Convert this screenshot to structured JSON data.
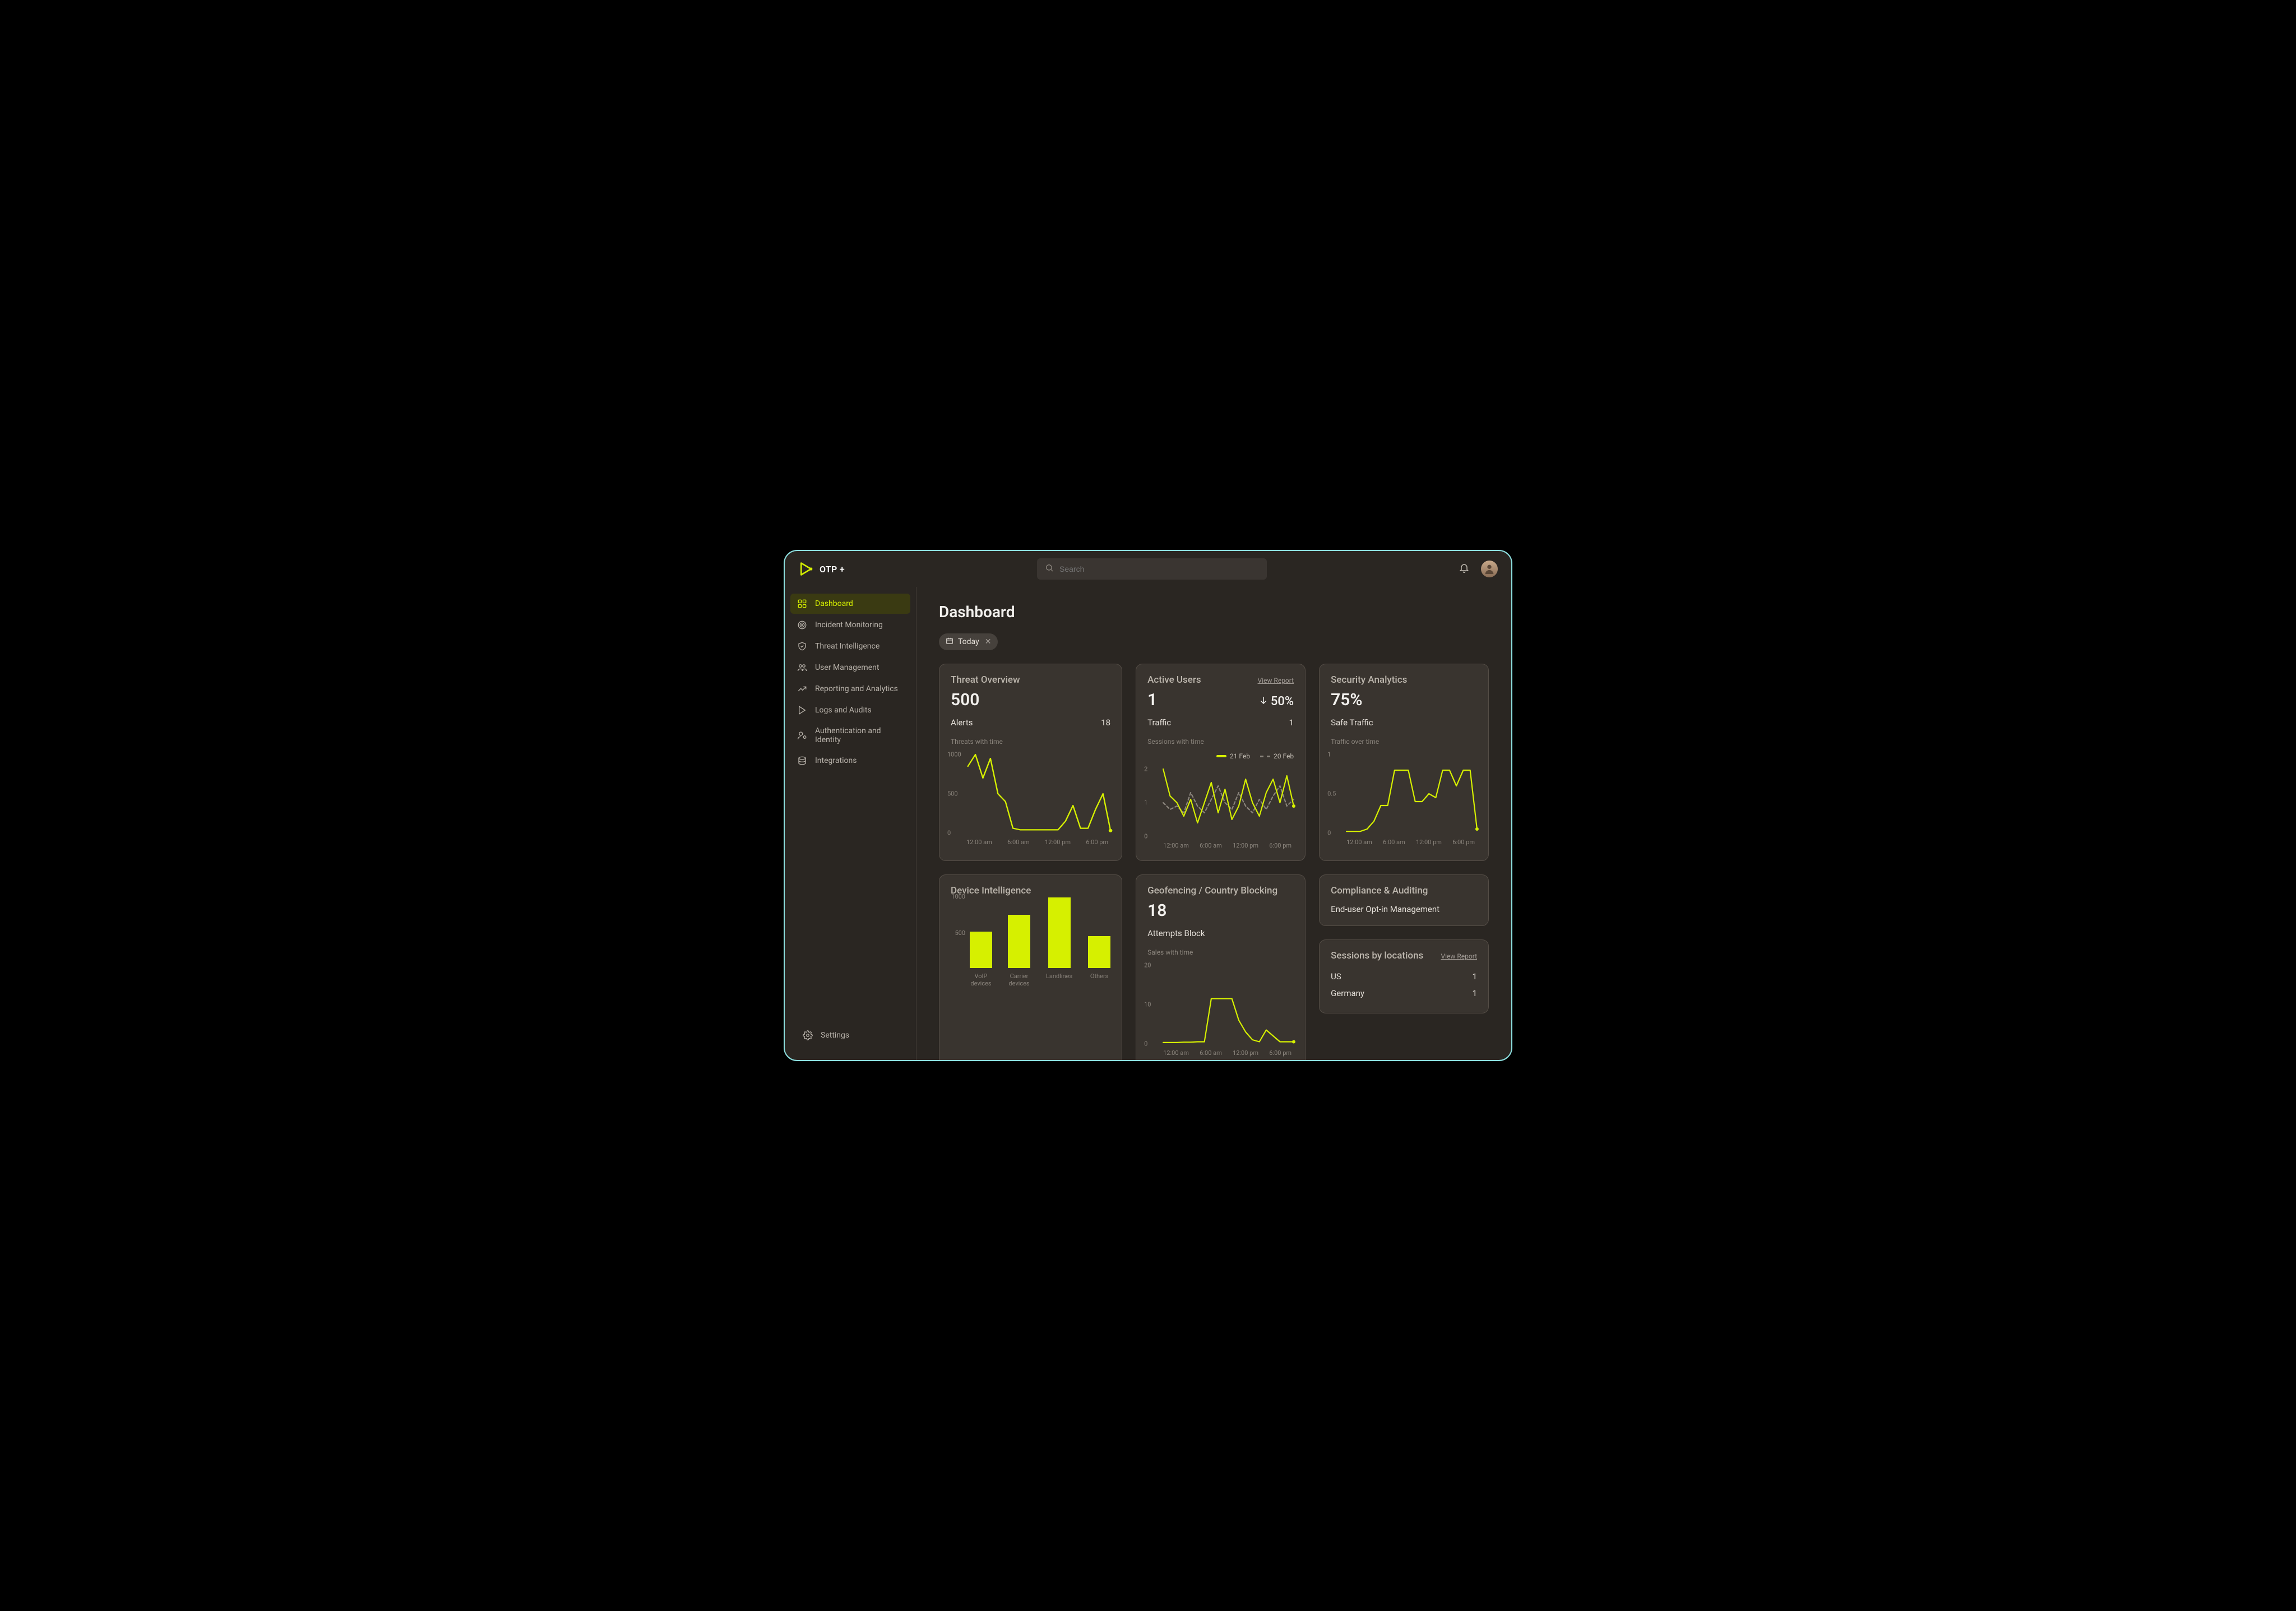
{
  "brand": "OTP +",
  "search": {
    "placeholder": "Search"
  },
  "sidebar": {
    "items": [
      {
        "label": "Dashboard",
        "active": true
      },
      {
        "label": "Incident Monitoring"
      },
      {
        "label": "Threat Intelligence"
      },
      {
        "label": "User Management"
      },
      {
        "label": "Reporting and Analytics"
      },
      {
        "label": "Logs and Audits"
      },
      {
        "label": "Authentication and Identity"
      },
      {
        "label": "Integrations"
      }
    ],
    "settings_label": "Settings"
  },
  "page": {
    "title": "Dashboard",
    "filter": {
      "label": "Today"
    }
  },
  "x_ticks_time": [
    "12:00 am",
    "6:00 am",
    "12:00 pm",
    "6:00 pm"
  ],
  "cards": {
    "threat": {
      "title": "Threat Overview",
      "metric": "500",
      "sub_label": "Alerts",
      "sub_value": "18",
      "chart_label": "Threats with time"
    },
    "active": {
      "title": "Active Users",
      "view_report": "View Report",
      "metric": "1",
      "delta": "50%",
      "sub_label": "Traffic",
      "sub_value": "1",
      "chart_label": "Sessions with time",
      "legend_a": "21 Feb",
      "legend_b": "20 Feb"
    },
    "security": {
      "title": "Security Analytics",
      "metric": "75%",
      "sub_label": "Safe Traffic",
      "chart_label": "Traffic over time"
    },
    "device": {
      "title": "Device Intelligence"
    },
    "geo": {
      "title": "Geofencing / Country Blocking",
      "metric": "18",
      "sub_label": "Attempts Block",
      "chart_label": "Sales with time"
    },
    "compliance": {
      "title": "Compliance & Auditing",
      "line1": "End-user Opt-in Management"
    },
    "sessions": {
      "title": "Sessions by locations",
      "view_report": "View Report",
      "rows": [
        {
          "label": "US",
          "value": "1"
        },
        {
          "label": "Germany",
          "value": "1"
        }
      ]
    }
  },
  "chart_data": [
    {
      "id": "threat",
      "type": "line",
      "title": "Threats with time",
      "x": [
        "12:00 am",
        "1:00",
        "2:00",
        "3:00",
        "4:00",
        "5:00",
        "6:00 am",
        "7:00",
        "8:00",
        "9:00",
        "10:00",
        "11:00",
        "12:00 pm",
        "1:00",
        "2:00",
        "3:00",
        "4:00",
        "5:00",
        "6:00 pm",
        "7:00"
      ],
      "values": [
        850,
        1000,
        700,
        950,
        500,
        400,
        60,
        40,
        40,
        40,
        40,
        40,
        40,
        150,
        350,
        60,
        60,
        300,
        500,
        30
      ],
      "ylim": [
        0,
        1000
      ],
      "yticks": [
        0,
        500,
        1000
      ]
    },
    {
      "id": "active",
      "type": "line",
      "title": "Sessions with time",
      "x": [
        "12:00 am",
        "1:00",
        "2:00",
        "3:00",
        "4:00",
        "5:00",
        "6:00 am",
        "7:00",
        "8:00",
        "9:00",
        "10:00",
        "11:00",
        "12:00 pm",
        "1:00",
        "2:00",
        "3:00",
        "4:00",
        "5:00",
        "6:00 pm",
        "7:00"
      ],
      "series": [
        {
          "name": "21 Feb",
          "values": [
            2.0,
            1.2,
            1.0,
            0.6,
            1.1,
            0.4,
            1.0,
            1.6,
            0.7,
            1.4,
            0.5,
            0.9,
            1.7,
            1.0,
            0.6,
            1.3,
            1.7,
            1.0,
            1.8,
            0.9
          ]
        },
        {
          "name": "20 Feb",
          "values": [
            1.0,
            0.8,
            0.9,
            0.7,
            1.3,
            0.9,
            0.7,
            1.1,
            1.5,
            1.0,
            0.8,
            1.3,
            0.9,
            0.7,
            1.1,
            0.8,
            1.2,
            1.5,
            0.9,
            1.1
          ]
        }
      ],
      "ylim": [
        0,
        2
      ],
      "yticks": [
        0,
        1,
        2
      ]
    },
    {
      "id": "security",
      "type": "line",
      "title": "Traffic over time",
      "x": [
        "12:00 am",
        "1:00",
        "2:00",
        "3:00",
        "4:00",
        "5:00",
        "6:00 am",
        "7:00",
        "8:00",
        "9:00",
        "10:00",
        "11:00",
        "12:00 pm",
        "1:00",
        "2:00",
        "3:00",
        "4:00",
        "5:00",
        "6:00 pm",
        "7:00"
      ],
      "values": [
        0.02,
        0.02,
        0.02,
        0.05,
        0.15,
        0.35,
        0.35,
        0.8,
        0.8,
        0.8,
        0.4,
        0.4,
        0.5,
        0.45,
        0.8,
        0.8,
        0.6,
        0.8,
        0.8,
        0.05
      ],
      "ylim": [
        0,
        1.0
      ],
      "yticks": [
        0,
        0.5,
        1.0
      ]
    },
    {
      "id": "device",
      "type": "bar",
      "categories": [
        "VoIP devices",
        "Carrier devices",
        "Landlines",
        "Others"
      ],
      "values": [
        500,
        730,
        970,
        440
      ],
      "ylim": [
        0,
        1000
      ],
      "yticks": [
        500,
        1000
      ]
    },
    {
      "id": "geo",
      "type": "line",
      "title": "Sales with time",
      "x": [
        "12:00 am",
        "1:00",
        "2:00",
        "3:00",
        "4:00",
        "5:00",
        "6:00 am",
        "7:00",
        "8:00",
        "9:00",
        "10:00",
        "11:00",
        "12:00 pm",
        "1:00",
        "2:00",
        "3:00",
        "4:00",
        "5:00",
        "6:00 pm",
        "7:00"
      ],
      "values": [
        0.3,
        0.3,
        0.3,
        0.4,
        0.4,
        0.5,
        0.5,
        11.5,
        11.5,
        11.5,
        11.5,
        6,
        3,
        1,
        0.5,
        3.5,
        2,
        0.5,
        0.5,
        0.5
      ],
      "ylim": [
        0,
        20
      ],
      "yticks": [
        0,
        10,
        20
      ]
    }
  ]
}
